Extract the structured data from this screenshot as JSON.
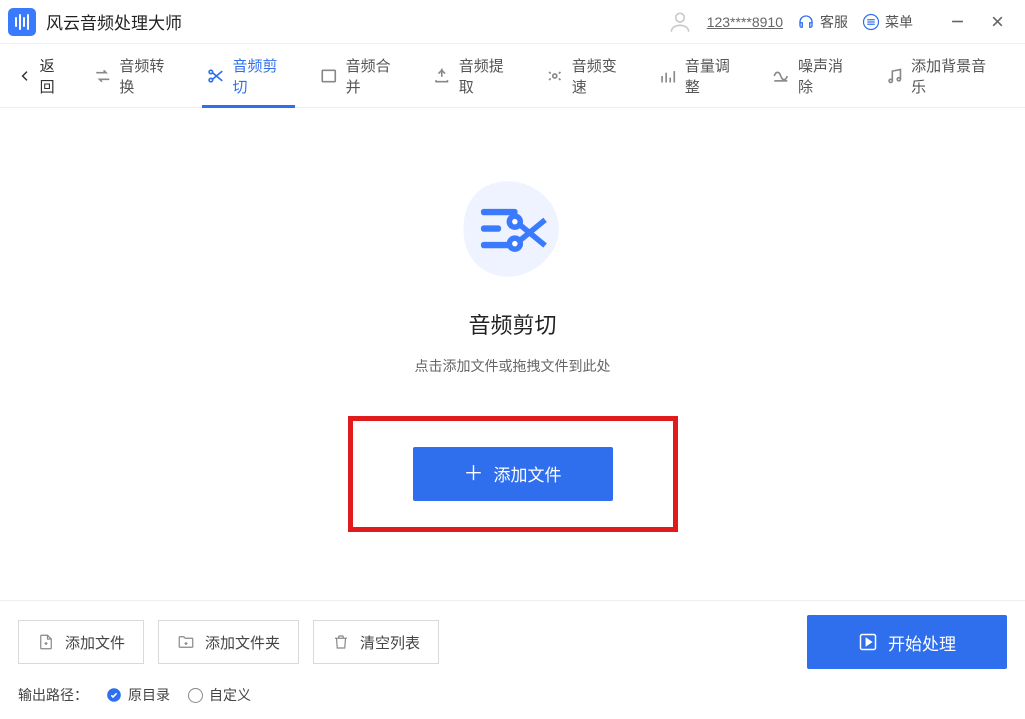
{
  "titlebar": {
    "app_name": "风云音频处理大师",
    "username": "123****8910",
    "service_label": "客服",
    "menu_label": "菜单"
  },
  "toolbar": {
    "back": "返回",
    "tabs": [
      {
        "label": "音频转换"
      },
      {
        "label": "音频剪切"
      },
      {
        "label": "音频合并"
      },
      {
        "label": "音频提取"
      },
      {
        "label": "音频变速"
      },
      {
        "label": "音量调整"
      },
      {
        "label": "噪声消除"
      },
      {
        "label": "添加背景音乐"
      }
    ],
    "active_index": 1
  },
  "main": {
    "title": "音频剪切",
    "subtitle": "点击添加文件或拖拽文件到此处",
    "add_button": "添加文件"
  },
  "bottom": {
    "add_file": "添加文件",
    "add_folder": "添加文件夹",
    "clear_list": "清空列表",
    "start": "开始处理",
    "output_label": "输出路径：",
    "radio_original": "原目录",
    "radio_custom": "自定义",
    "radio_selected": "original"
  },
  "colors": {
    "accent": "#2f6fed",
    "highlight_border": "#e11b1b"
  }
}
